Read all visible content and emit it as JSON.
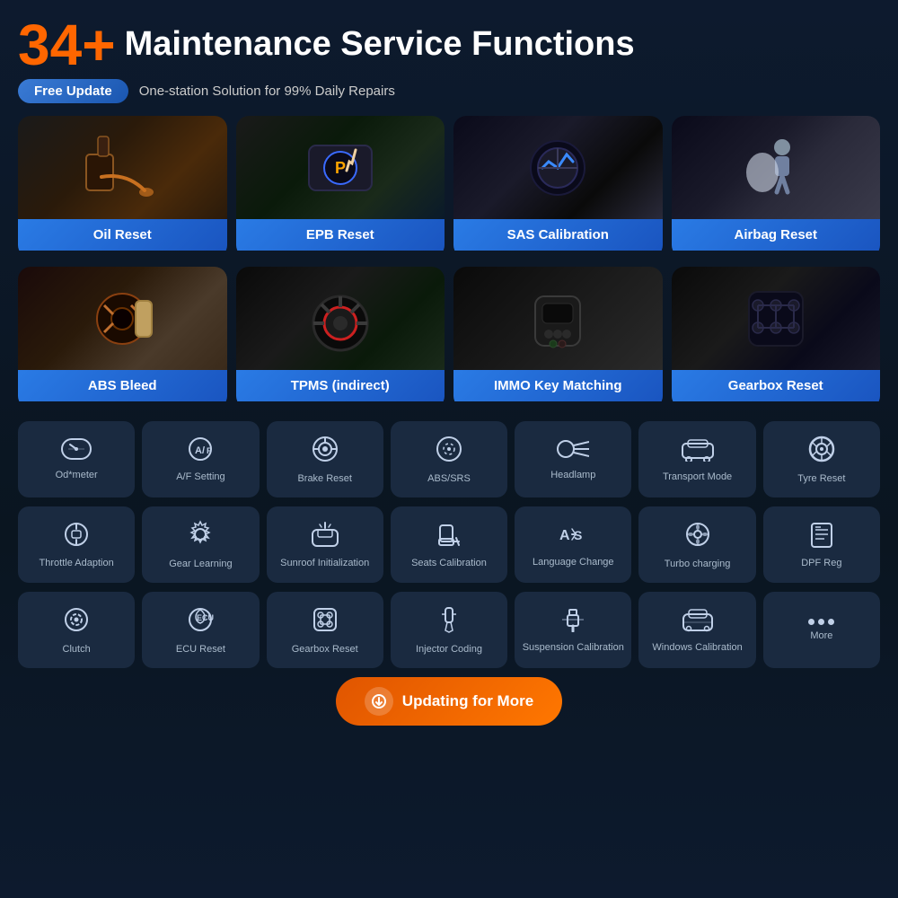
{
  "header": {
    "number": "34+",
    "title": "Maintenance Service Functions",
    "badge": "Free Update",
    "subtitle": "One-station Solution for 99% Daily Repairs"
  },
  "top_cards": [
    {
      "label": "Oil Reset",
      "img_class": "img-oil",
      "emoji": "🛢️"
    },
    {
      "label": "EPB Reset",
      "img_class": "img-epb",
      "emoji": "🅿️"
    },
    {
      "label": "SAS Calibration",
      "img_class": "img-sas",
      "emoji": "🚗"
    },
    {
      "label": "Airbag Reset",
      "img_class": "img-airbag",
      "emoji": "💺"
    }
  ],
  "mid_cards": [
    {
      "label": "ABS Bleed",
      "img_class": "img-abs",
      "emoji": "🔧"
    },
    {
      "label": "TPMS (indirect)",
      "img_class": "img-tpms",
      "emoji": "🔩"
    },
    {
      "label": "IMMO Key Matching",
      "img_class": "img-immo",
      "emoji": "🔑"
    },
    {
      "label": "Gearbox Reset",
      "img_class": "img-gearbox",
      "emoji": "⚙️"
    }
  ],
  "icon_row1": [
    {
      "label": "Od*meter",
      "symbol": "⏱"
    },
    {
      "label": "A/F Setting",
      "symbol": "A/F"
    },
    {
      "label": "Brake Reset",
      "symbol": "◎"
    },
    {
      "label": "ABS/SRS",
      "symbol": "⊙"
    },
    {
      "label": "Headlamp",
      "symbol": "⬤D"
    },
    {
      "label": "Transport Mode",
      "symbol": "🚗"
    },
    {
      "label": "Tyre Reset",
      "symbol": "⚙"
    }
  ],
  "icon_row2": [
    {
      "label": "Throttle Adaption",
      "symbol": "◎"
    },
    {
      "label": "Gear Learning",
      "symbol": "⚙"
    },
    {
      "label": "Sunroof Initialization",
      "symbol": "⊡"
    },
    {
      "label": "Seats Calibration",
      "symbol": "💺"
    },
    {
      "label": "Language Change",
      "symbol": "A⇄"
    },
    {
      "label": "Turbo charging",
      "symbol": "⚙"
    },
    {
      "label": "DPF Reg",
      "symbol": "≡"
    }
  ],
  "icon_row3": [
    {
      "label": "Clutch",
      "symbol": "◎"
    },
    {
      "label": "ECU Reset",
      "symbol": "⚙"
    },
    {
      "label": "Gearbox Reset",
      "symbol": "⊞"
    },
    {
      "label": "Injector Coding",
      "symbol": "↗"
    },
    {
      "label": "Suspension Calibration",
      "symbol": "⬌"
    },
    {
      "label": "Windows Calibration",
      "symbol": "🚗"
    },
    {
      "label": "More",
      "symbol": "..."
    }
  ],
  "update_button": "Updating for More"
}
